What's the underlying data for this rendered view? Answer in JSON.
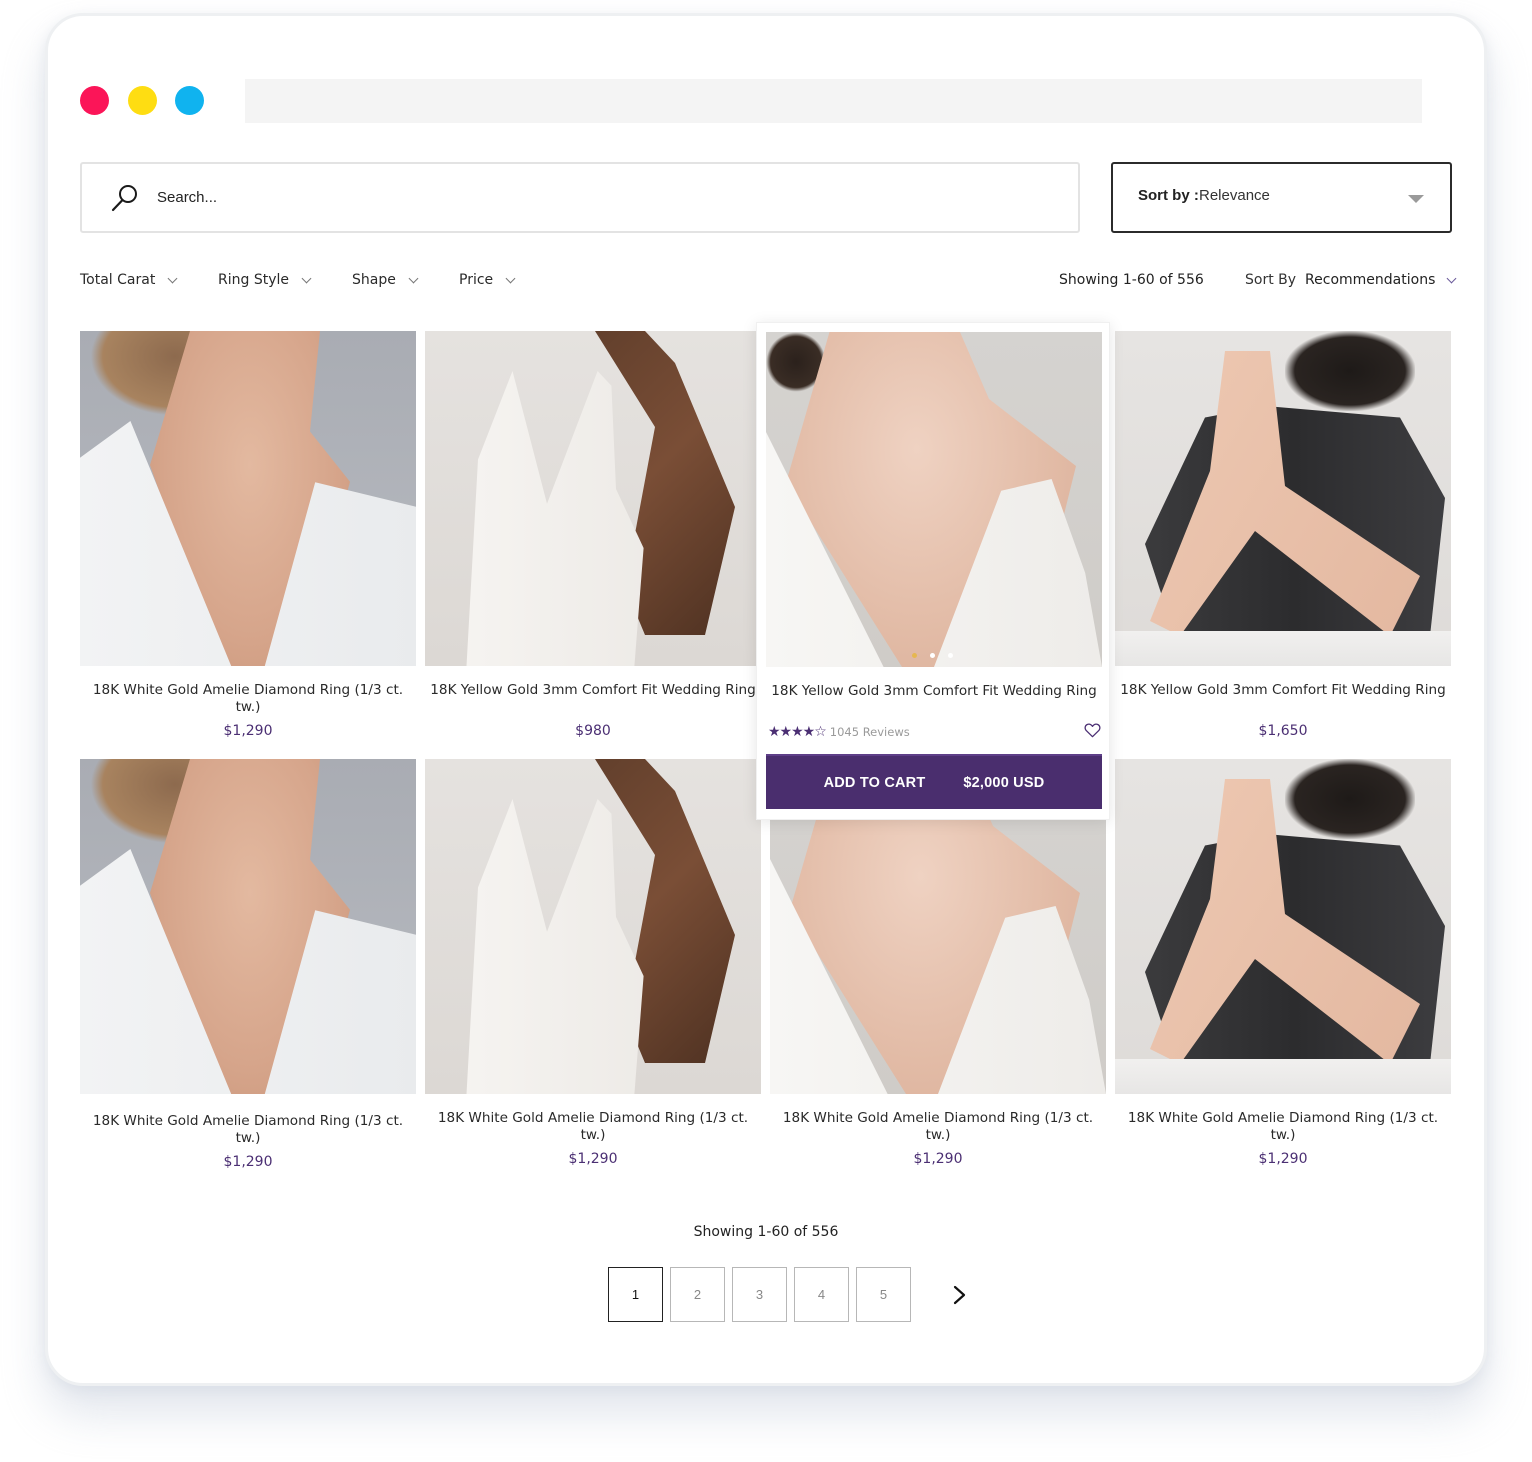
{
  "window": {
    "traffic_lights": [
      {
        "name": "close",
        "color": "#fb1558"
      },
      {
        "name": "minimize",
        "color": "#fedd12"
      },
      {
        "name": "maximize",
        "color": "#10b3ef"
      }
    ],
    "address_bar_value": ""
  },
  "search": {
    "placeholder": "Search...",
    "icon": "search-icon"
  },
  "sort_dropdown": {
    "label": "Sort by :",
    "value": "Relevance",
    "icon": "caret-down-icon"
  },
  "filters": [
    {
      "label": "Total Carat"
    },
    {
      "label": "Ring Style"
    },
    {
      "label": "Shape"
    },
    {
      "label": "Price"
    }
  ],
  "results": {
    "showing_text": "Showing 1-60 of  556",
    "sort_by_label": "Sort By",
    "sort_by_value": "Recommendations"
  },
  "products": [
    {
      "title": "18K White Gold Amelie Diamond Ring (1/3 ct. tw.)",
      "price": "$1,290"
    },
    {
      "title": "18K Yellow Gold 3mm Comfort Fit Wedding Ring",
      "price": "$980"
    },
    {
      "title": "18K Yellow Gold 3mm Comfort Fit Wedding Ring",
      "rating": 4,
      "rating_max": 5,
      "reviews": "1045 Reviews",
      "add_to_cart_label": "ADD TO CART",
      "add_to_cart_price": "$2,000 USD",
      "carousel_slides": 3,
      "carousel_active": 1
    },
    {
      "title": "18K Yellow Gold 3mm Comfort Fit Wedding Ring",
      "price": "$1,650"
    },
    {
      "title": "18K White Gold Amelie Diamond Ring (1/3 ct. tw.)",
      "price": "$1,290"
    },
    {
      "title": "18K White Gold Amelie Diamond Ring (1/3 ct. tw.)",
      "price": "$1,290"
    },
    {
      "title": "18K White Gold Amelie Diamond Ring (1/3 ct. tw.)",
      "price": "$1,290"
    },
    {
      "title": "18K White Gold Amelie Diamond Ring (1/3 ct. tw.)",
      "price": "$1,290"
    }
  ],
  "stars_text": "★★★★☆",
  "pagination": {
    "showing_text": "Showing 1-60 of  556",
    "pages": [
      "1",
      "2",
      "3",
      "4",
      "5"
    ],
    "current": "1",
    "next_icon": "chevron-right-icon"
  },
  "colors": {
    "accent": "#4a2e6e",
    "price": "#4b2f73",
    "carousel_active": "#e6b751"
  }
}
